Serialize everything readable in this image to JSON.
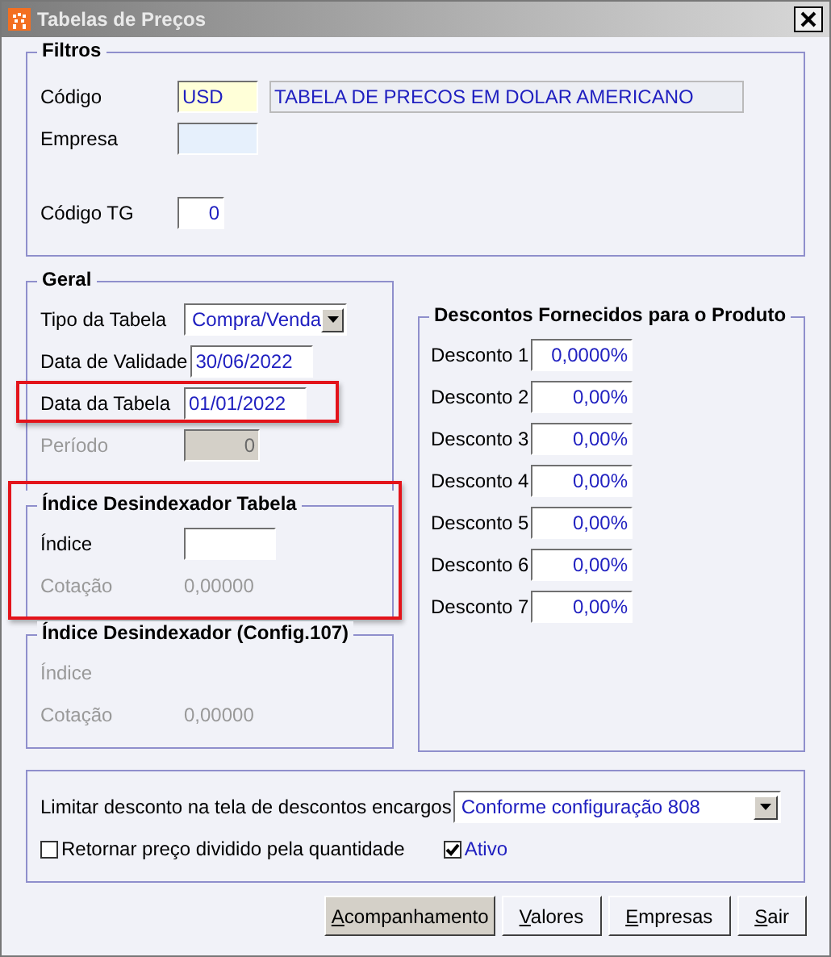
{
  "window": {
    "title": "Tabelas de Preços"
  },
  "filtros": {
    "title": "Filtros",
    "codigo": {
      "label": "Código",
      "value": "USD",
      "description": "TABELA DE PRECOS EM DOLAR AMERICANO"
    },
    "empresa": {
      "label": "Empresa"
    },
    "codigo_tg": {
      "label": "Código TG",
      "value": "0"
    }
  },
  "geral": {
    "title": "Geral",
    "fields": [
      {
        "kind": "select",
        "label": "Tipo da Tabela",
        "value": "Compra/Venda",
        "highlighted": false,
        "disabled": false
      },
      {
        "kind": "date",
        "label": "Data de Validade",
        "value": "30/06/2022",
        "highlighted": false,
        "disabled": false
      },
      {
        "kind": "date",
        "label": "Data da Tabela",
        "value": "01/01/2022",
        "highlighted": true,
        "disabled": false
      },
      {
        "kind": "number",
        "label": "Período",
        "value": "0",
        "highlighted": false,
        "disabled": true
      }
    ]
  },
  "indice_groups": [
    {
      "title": "Índice Desindexador Tabela",
      "highlighted": true,
      "indice_label": "Índice",
      "indice_disabled": false,
      "cotacao_label": "Cotação",
      "cotacao_value": "0,00000"
    },
    {
      "title": "Índice Desindexador (Config.107)",
      "highlighted": false,
      "indice_label": "Índice",
      "indice_disabled": true,
      "cotacao_label": "Cotação",
      "cotacao_value": "0,00000"
    }
  ],
  "descontos": {
    "title": "Descontos Fornecidos para o Produto",
    "items": [
      {
        "label": "Desconto 1",
        "value": "0,0000%"
      },
      {
        "label": "Desconto 2",
        "value": "0,00%"
      },
      {
        "label": "Desconto 3",
        "value": "0,00%"
      },
      {
        "label": "Desconto 4",
        "value": "0,00%"
      },
      {
        "label": "Desconto 5",
        "value": "0,00%"
      },
      {
        "label": "Desconto 6",
        "value": "0,00%"
      },
      {
        "label": "Desconto 7",
        "value": "0,00%"
      }
    ]
  },
  "limite": {
    "label": "Limitar desconto na tela de descontos encargos",
    "value": "Conforme configuração 808"
  },
  "checkboxes": [
    {
      "label": "Retornar preço dividido pela quantidade",
      "checked": false
    },
    {
      "label": "Ativo",
      "checked": true
    }
  ],
  "buttons": [
    {
      "label": "Acompanhamento",
      "selected": true
    },
    {
      "label": "Valores",
      "selected": false
    },
    {
      "label": "Empresas",
      "selected": false
    },
    {
      "label": "Sair",
      "selected": false
    }
  ]
}
